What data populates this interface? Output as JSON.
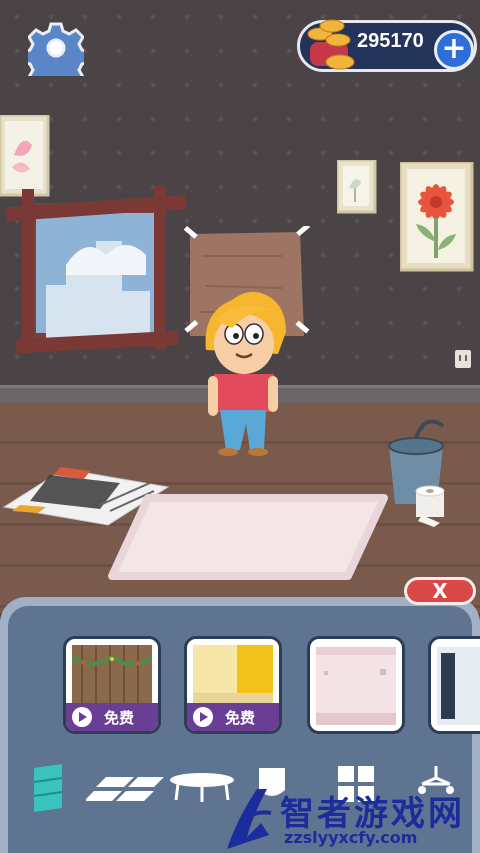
{
  "hud": {
    "settings_icon": "gear-icon",
    "coins": "295170",
    "add_icon": "plus-icon",
    "add_label": "+"
  },
  "scene": {
    "objects": [
      "flower-painting",
      "small-flower-painting",
      "pink-flower-painting",
      "window",
      "wooden-sign",
      "character",
      "newspaper",
      "bucket",
      "toilet-paper",
      "fluffy-rug",
      "power-outlet"
    ]
  },
  "panel": {
    "close_label": "X",
    "cards": [
      {
        "label": "免费",
        "thumb": "wooden-wall-with-garland"
      },
      {
        "label": "免费",
        "thumb": "yellow-wall"
      },
      {
        "label": "",
        "thumb": "pink-wall"
      }
    ],
    "tools": [
      "wall-panel-icon",
      "floor-tiles-icon",
      "table-icon",
      "sink-icon",
      "window-icon",
      "ceiling-lamp-icon"
    ]
  },
  "watermark": {
    "title": "智者游戏网",
    "url": "zzslyyxcfy.com"
  },
  "colors": {
    "wall": "#4b4447",
    "floor": "#7a5a4c",
    "panel": "#5f7491",
    "coin_panel": "#24335a",
    "plus": "#2f6ed8",
    "close": "#d94846",
    "free_bar": "#6b3e96",
    "watermark": "#1c2c9c"
  }
}
